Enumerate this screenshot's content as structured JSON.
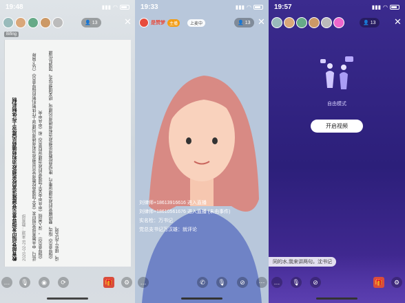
{
  "panels": [
    {
      "status": {
        "time": "19:48"
      },
      "viewer_count": "13",
      "tag": "Bifing",
      "document": {
        "title": "教育部党组印发指导意见党建推进高校思想政治和师德师风建设工作体制机制",
        "date": "2020-02-28 来源：教育部",
        "paragraphs": [
          "近日，中共教育部党组印发《关于加强高校教师党员思想政治和师德师风建设工作体制机制的指导意见》（以下简称《指导意见》），深入贯彻《中共中央关于加强党的政治建设的意见》和《中共中央",
          "《指导意见》指出，要把握党的政治建设重点，推动高校教师思想政治和师德师风建设，把关理想信念，加强队伍建设，提升工作实效。"
        ]
      },
      "toolbar_icons": [
        "chat-icon",
        "mic-icon",
        "camera-icon",
        "flip-icon",
        "gift-icon",
        "gear-icon"
      ]
    },
    {
      "status": {
        "time": "19:33"
      },
      "host": {
        "name": "是赞梦",
        "badge": "主播",
        "mic_label": "上麦中"
      },
      "viewer_count": "13",
      "feed": [
        "刘律师+18613916616 进入直播",
        "刘律师+18610561676 进入直播 (未由事件)",
        "实名检：万书记",
        "党总支书记万汉雄：就评论"
      ],
      "toolbar_icons": [
        "chat-icon",
        "phone-icon",
        "mic-icon",
        "camera-off-icon",
        "more-icon"
      ]
    },
    {
      "status": {
        "time": "19:57"
      },
      "viewer_count": "13",
      "mode_label": "自由模式",
      "start_button": "开启视频",
      "chat_message": "同的水,我来讲两句。沈书记",
      "toolbar_icons": [
        "chat-icon",
        "mic-icon",
        "camera-off-icon",
        "gift-icon",
        "gear-icon"
      ]
    }
  ]
}
